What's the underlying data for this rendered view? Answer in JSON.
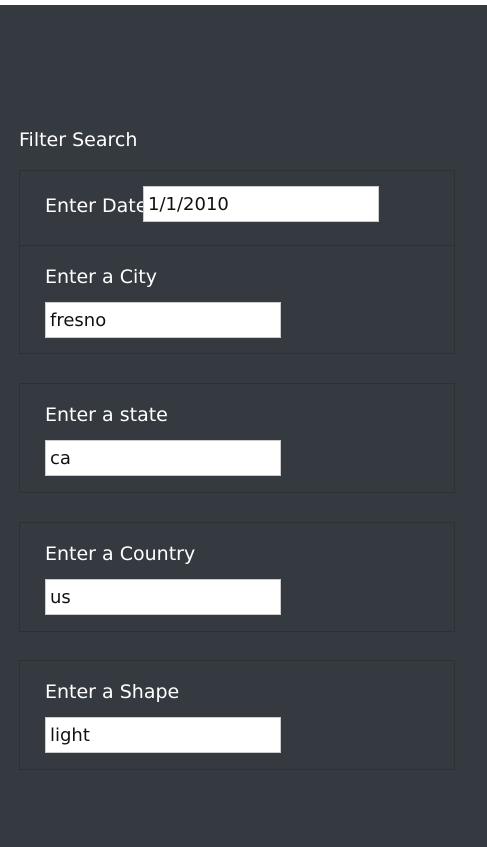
{
  "filter": {
    "title": "Filter Search",
    "date": {
      "label": "Enter Date",
      "value": "1/1/2010"
    },
    "city": {
      "label": "Enter a City",
      "value": "fresno"
    },
    "state": {
      "label": "Enter a state",
      "value": "ca"
    },
    "country": {
      "label": "Enter a Country",
      "value": "us"
    },
    "shape": {
      "label": "Enter a Shape",
      "value": "light"
    }
  },
  "colors": {
    "panel_background": "#343a40",
    "text": "#ffffff",
    "input_background": "#ffffff"
  }
}
